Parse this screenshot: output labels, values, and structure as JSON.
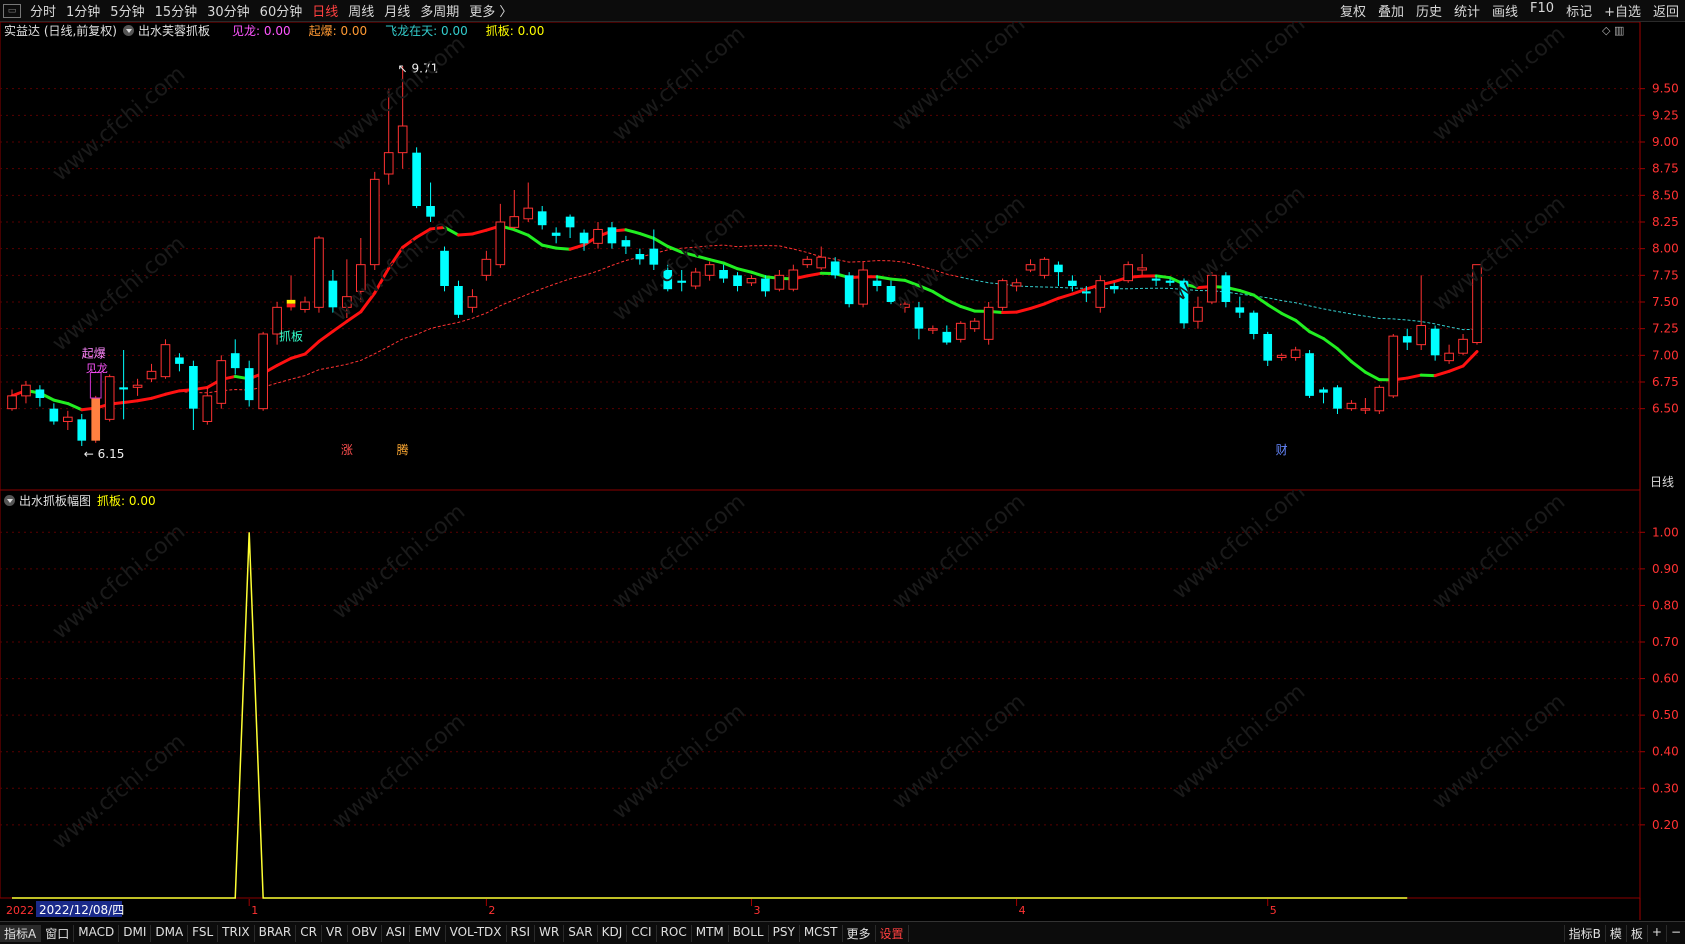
{
  "topbar": {
    "items": [
      {
        "label": "分时",
        "active": false
      },
      {
        "label": "1分钟",
        "active": false
      },
      {
        "label": "5分钟",
        "active": false
      },
      {
        "label": "15分钟",
        "active": false
      },
      {
        "label": "30分钟",
        "active": false
      },
      {
        "label": "60分钟",
        "active": false
      },
      {
        "label": "日线",
        "active": true
      },
      {
        "label": "周线",
        "active": false
      },
      {
        "label": "月线",
        "active": false
      },
      {
        "label": "多周期",
        "active": false
      },
      {
        "label": "更多 〉",
        "active": false
      }
    ],
    "right": [
      "复权",
      "叠加",
      "历史",
      "统计",
      "画线",
      "F10",
      "标记",
      "+自选",
      "返回"
    ]
  },
  "main": {
    "stock_title": "实益达 (日线,前复权)",
    "indicator_name": "出水芙蓉抓板",
    "legend": [
      {
        "label": "见龙: 0.00",
        "color": "#ff55ff"
      },
      {
        "label": "起爆: 0.00",
        "color": "#ff9933"
      },
      {
        "label": "飞龙在天: 0.00",
        "color": "#33cccc"
      },
      {
        "label": "抓板: 0.00",
        "color": "#ffff00"
      }
    ],
    "axis_label": "日线",
    "high_label": "9.71",
    "low_label": "6.15",
    "signals": {
      "jianlong": "见龙",
      "qibao": "起爆",
      "zhuaban": "抓板"
    },
    "markers": {
      "zhang": "涨",
      "shen": "腾",
      "cai": "财"
    }
  },
  "sub": {
    "indicator_name": "出水抓板幅图",
    "legend": "抓板: 0.00",
    "legend_color": "#ffff00"
  },
  "time_axis": {
    "year_label": "2022",
    "cursor_date": "2022/12/08/四",
    "month_ticks": [
      "1",
      "2",
      "3",
      "4",
      "5"
    ]
  },
  "bottombar": {
    "tabs": [
      "指标A",
      "窗口",
      "MACD",
      "DMI",
      "DMA",
      "FSL",
      "TRIX",
      "BRAR",
      "CR",
      "VR",
      "OBV",
      "ASI",
      "EMV",
      "VOL-TDX",
      "RSI",
      "WR",
      "SAR",
      "KDJ",
      "CCI",
      "ROC",
      "MTM",
      "BOLL",
      "PSY",
      "MCST",
      "更多",
      "设置"
    ],
    "right": [
      "指标B",
      "模",
      "板",
      "+",
      "−"
    ]
  },
  "chart_data": [
    {
      "type": "candlestick",
      "ylim": [
        6.0,
        9.9
      ],
      "y_ticks": [
        6.5,
        6.75,
        7.0,
        7.25,
        7.5,
        7.75,
        8.0,
        8.25,
        8.5,
        8.75,
        9.0,
        9.25,
        9.5
      ],
      "colors": {
        "up": "#ff3232",
        "down": "#00ffff",
        "ma_up": "#ff1111",
        "ma_down": "#22ee22",
        "ma_long": "#ff3232",
        "ma_long_late": "#33cccc"
      },
      "candles": [
        [
          6.5,
          6.62,
          6.68,
          6.48
        ],
        [
          6.62,
          6.72,
          6.76,
          6.55
        ],
        [
          6.68,
          6.6,
          6.72,
          6.52
        ],
        [
          6.5,
          6.38,
          6.55,
          6.35
        ],
        [
          6.38,
          6.42,
          6.48,
          6.3
        ],
        [
          6.4,
          6.2,
          6.45,
          6.15
        ],
        [
          6.2,
          6.6,
          6.62,
          6.18
        ],
        [
          6.4,
          6.8,
          6.82,
          6.38
        ],
        [
          6.7,
          6.68,
          7.05,
          6.4
        ],
        [
          6.7,
          6.72,
          6.78,
          6.62
        ],
        [
          6.78,
          6.85,
          6.92,
          6.75
        ],
        [
          6.8,
          7.1,
          7.15,
          6.78
        ],
        [
          6.98,
          6.92,
          7.02,
          6.85
        ],
        [
          6.9,
          6.5,
          6.95,
          6.3
        ],
        [
          6.38,
          6.62,
          6.7,
          6.35
        ],
        [
          6.55,
          6.95,
          7.0,
          6.5
        ],
        [
          7.02,
          6.88,
          7.15,
          6.82
        ],
        [
          6.88,
          6.58,
          6.95,
          6.52
        ],
        [
          6.5,
          7.2,
          7.22,
          6.48
        ],
        [
          7.2,
          7.45,
          7.5,
          7.1
        ],
        [
          7.45,
          7.52,
          7.75,
          7.42
        ],
        [
          7.43,
          7.5,
          7.55,
          7.4
        ],
        [
          7.45,
          8.1,
          8.12,
          7.4
        ],
        [
          7.7,
          7.45,
          7.8,
          7.4
        ],
        [
          7.45,
          7.55,
          7.9,
          7.35
        ],
        [
          7.6,
          7.85,
          8.1,
          7.5
        ],
        [
          7.85,
          8.65,
          8.72,
          7.8
        ],
        [
          8.7,
          8.9,
          9.5,
          8.6
        ],
        [
          8.9,
          9.15,
          9.71,
          8.75
        ],
        [
          8.9,
          8.4,
          8.95,
          8.38
        ],
        [
          8.4,
          8.3,
          8.62,
          8.25
        ],
        [
          7.98,
          7.65,
          8.02,
          7.6
        ],
        [
          7.65,
          7.38,
          7.7,
          7.35
        ],
        [
          7.45,
          7.55,
          7.62,
          7.4
        ],
        [
          7.75,
          7.9,
          7.98,
          7.7
        ],
        [
          7.85,
          8.25,
          8.42,
          7.82
        ],
        [
          8.2,
          8.3,
          8.55,
          8.18
        ],
        [
          8.28,
          8.38,
          8.62,
          8.25
        ],
        [
          8.35,
          8.22,
          8.4,
          8.18
        ],
        [
          8.15,
          8.12,
          8.2,
          8.05
        ],
        [
          8.3,
          8.2,
          8.32,
          8.1
        ],
        [
          8.15,
          8.05,
          8.18,
          7.98
        ],
        [
          8.05,
          8.18,
          8.25,
          8.0
        ],
        [
          8.2,
          8.05,
          8.25,
          8.0
        ],
        [
          8.08,
          8.02,
          8.12,
          7.95
        ],
        [
          7.95,
          7.9,
          8.0,
          7.85
        ],
        [
          8.0,
          7.85,
          8.18,
          7.8
        ],
        [
          7.8,
          7.62,
          7.85,
          7.6
        ],
        [
          7.7,
          7.68,
          7.8,
          7.6
        ],
        [
          7.65,
          7.78,
          7.82,
          7.62
        ],
        [
          7.75,
          7.85,
          7.88,
          7.7
        ],
        [
          7.8,
          7.72,
          7.85,
          7.68
        ],
        [
          7.75,
          7.65,
          7.78,
          7.6
        ],
        [
          7.68,
          7.72,
          7.75,
          7.65
        ],
        [
          7.72,
          7.6,
          7.75,
          7.55
        ],
        [
          7.62,
          7.75,
          7.8,
          7.6
        ],
        [
          7.62,
          7.8,
          7.85,
          7.6
        ],
        [
          7.85,
          7.9,
          7.93,
          7.82
        ],
        [
          7.82,
          7.92,
          8.02,
          7.8
        ],
        [
          7.88,
          7.75,
          7.92,
          7.72
        ],
        [
          7.75,
          7.48,
          7.78,
          7.45
        ],
        [
          7.48,
          7.8,
          7.88,
          7.45
        ],
        [
          7.7,
          7.65,
          7.75,
          7.6
        ],
        [
          7.65,
          7.5,
          7.7,
          7.48
        ],
        [
          7.45,
          7.48,
          7.52,
          7.4
        ],
        [
          7.45,
          7.25,
          7.5,
          7.15
        ],
        [
          7.25,
          7.25,
          7.28,
          7.2
        ],
        [
          7.22,
          7.12,
          7.28,
          7.1
        ],
        [
          7.15,
          7.3,
          7.32,
          7.12
        ],
        [
          7.25,
          7.32,
          7.35,
          7.22
        ],
        [
          7.15,
          7.45,
          7.5,
          7.1
        ],
        [
          7.45,
          7.7,
          7.72,
          7.42
        ],
        [
          7.65,
          7.68,
          7.72,
          7.6
        ],
        [
          7.8,
          7.85,
          7.9,
          7.78
        ],
        [
          7.75,
          7.9,
          7.92,
          7.72
        ],
        [
          7.85,
          7.78,
          7.88,
          7.65
        ],
        [
          7.7,
          7.65,
          7.75,
          7.6
        ],
        [
          7.6,
          7.58,
          7.65,
          7.5
        ],
        [
          7.45,
          7.7,
          7.75,
          7.4
        ],
        [
          7.65,
          7.62,
          7.68,
          7.58
        ],
        [
          7.7,
          7.85,
          7.88,
          7.68
        ],
        [
          7.8,
          7.82,
          7.95,
          7.75
        ],
        [
          7.72,
          7.7,
          7.75,
          7.65
        ],
        [
          7.7,
          7.68,
          7.72,
          7.65
        ],
        [
          7.7,
          7.3,
          7.72,
          7.25
        ],
        [
          7.32,
          7.45,
          7.55,
          7.25
        ],
        [
          7.5,
          7.75,
          7.78,
          7.48
        ],
        [
          7.75,
          7.5,
          7.78,
          7.45
        ],
        [
          7.45,
          7.4,
          7.55,
          7.35
        ],
        [
          7.4,
          7.2,
          7.42,
          7.15
        ],
        [
          7.2,
          6.95,
          7.22,
          6.9
        ],
        [
          6.98,
          7.0,
          7.02,
          6.95
        ],
        [
          6.98,
          7.05,
          7.08,
          6.95
        ],
        [
          7.02,
          6.62,
          7.05,
          6.6
        ],
        [
          6.68,
          6.65,
          6.7,
          6.55
        ],
        [
          6.7,
          6.5,
          6.72,
          6.45
        ],
        [
          6.5,
          6.55,
          6.58,
          6.48
        ],
        [
          6.5,
          6.5,
          6.6,
          6.45
        ],
        [
          6.48,
          6.7,
          6.72,
          6.45
        ],
        [
          6.62,
          7.18,
          7.2,
          6.6
        ],
        [
          7.18,
          7.12,
          7.25,
          7.05
        ],
        [
          7.1,
          7.28,
          7.75,
          7.05
        ],
        [
          7.25,
          7.0,
          7.28,
          6.95
        ],
        [
          6.95,
          7.02,
          7.1,
          6.92
        ],
        [
          7.02,
          7.15,
          7.2,
          7.0
        ],
        [
          7.12,
          7.85,
          7.85,
          7.1
        ]
      ]
    },
    {
      "type": "line",
      "series": [
        {
          "values": [
            0,
            1,
            0
          ]
        }
      ],
      "x": [
        16,
        17,
        18
      ],
      "x_count": 101,
      "ylim": [
        0,
        1.05
      ],
      "y_ticks": [
        0.2,
        0.3,
        0.4,
        0.5,
        0.6,
        0.7,
        0.8,
        0.9,
        1.0
      ],
      "color": "#ffff33"
    }
  ]
}
